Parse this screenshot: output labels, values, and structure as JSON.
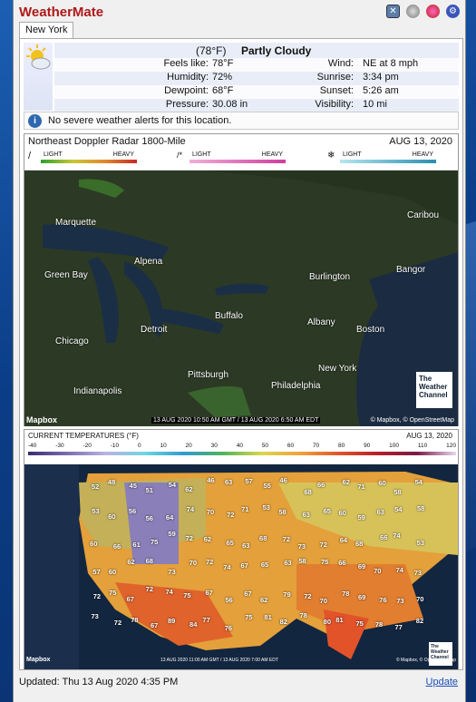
{
  "app": {
    "title": "WeatherMate"
  },
  "tab": {
    "label": "New York"
  },
  "current": {
    "temp": "(78°F)",
    "condition": "Partly Cloudy",
    "rows": [
      {
        "l": "Feels like:",
        "lv": "78°F",
        "r": "Wind:",
        "rv": "NE at 8 mph"
      },
      {
        "l": "Humidity:",
        "lv": "72%",
        "r": "Sunrise:",
        "rv": "3:34 pm"
      },
      {
        "l": "Dewpoint:",
        "lv": "68°F",
        "r": "Sunset:",
        "rv": "5:26 am"
      },
      {
        "l": "Pressure:",
        "lv": "30.08 in",
        "r": "Visibility:",
        "rv": "10 mi"
      }
    ]
  },
  "alert": {
    "text": "No severe weather alerts for this location."
  },
  "radar": {
    "title": "Northeast Doppler Radar 1800-Mile",
    "date": "AUG 13, 2020",
    "light": "LIGHT",
    "heavy": "HEAVY",
    "cities": [
      "Marquette",
      "Caribou",
      "Alpena",
      "Green Bay",
      "Burlington",
      "Bangor",
      "Buffalo",
      "Detroit",
      "Albany",
      "Boston",
      "Chicago",
      "New York",
      "Pittsburgh",
      "Philadelphia",
      "Indianapolis"
    ],
    "timestamp": "13 AUG 2020 10:50 AM GMT / 13 AUG 2020 6:50 AM EDT",
    "brand": "Mapbox",
    "copyright": "© Mapbox, © OpenStreetMap",
    "twc": [
      "The",
      "Weather",
      "Channel"
    ]
  },
  "temps": {
    "title": "CURRENT TEMPERATURES (°F)",
    "date": "AUG 13, 2020",
    "scale": [
      "-40",
      "-30",
      "-20",
      "-10",
      "0",
      "10",
      "20",
      "30",
      "40",
      "50",
      "60",
      "70",
      "80",
      "90",
      "100",
      "110",
      "120"
    ],
    "values": [
      "52",
      "48",
      "45",
      "51",
      "54",
      "62",
      "46",
      "63",
      "57",
      "55",
      "46",
      "68",
      "66",
      "62",
      "71",
      "60",
      "58",
      "54",
      "53",
      "60",
      "56",
      "56",
      "64",
      "74",
      "70",
      "72",
      "71",
      "53",
      "58",
      "63",
      "65",
      "60",
      "59",
      "63",
      "54",
      "58",
      "60",
      "66",
      "61",
      "75",
      "59",
      "72",
      "62",
      "65",
      "63",
      "68",
      "72",
      "73",
      "72",
      "64",
      "68",
      "66",
      "74",
      "53",
      "57",
      "60",
      "62",
      "68",
      "73",
      "70",
      "72",
      "74",
      "67",
      "65",
      "63",
      "58",
      "75",
      "66",
      "69",
      "70",
      "74",
      "73",
      "72",
      "75",
      "67",
      "72",
      "74",
      "75",
      "67",
      "56",
      "67",
      "62",
      "79",
      "72",
      "70",
      "78",
      "69",
      "76",
      "73",
      "70",
      "73",
      "72",
      "78",
      "67",
      "89",
      "84",
      "77",
      "76",
      "75",
      "81",
      "82",
      "78",
      "80",
      "81",
      "75",
      "78",
      "77",
      "82"
    ],
    "footer_stamp": "13 AUG 2020 11:00 AM GMT / 13 AUG 2020 7:00 AM EDT"
  },
  "status": {
    "updated": "Updated: Thu 13 Aug 2020  4:35 PM",
    "update_link": "Update"
  }
}
